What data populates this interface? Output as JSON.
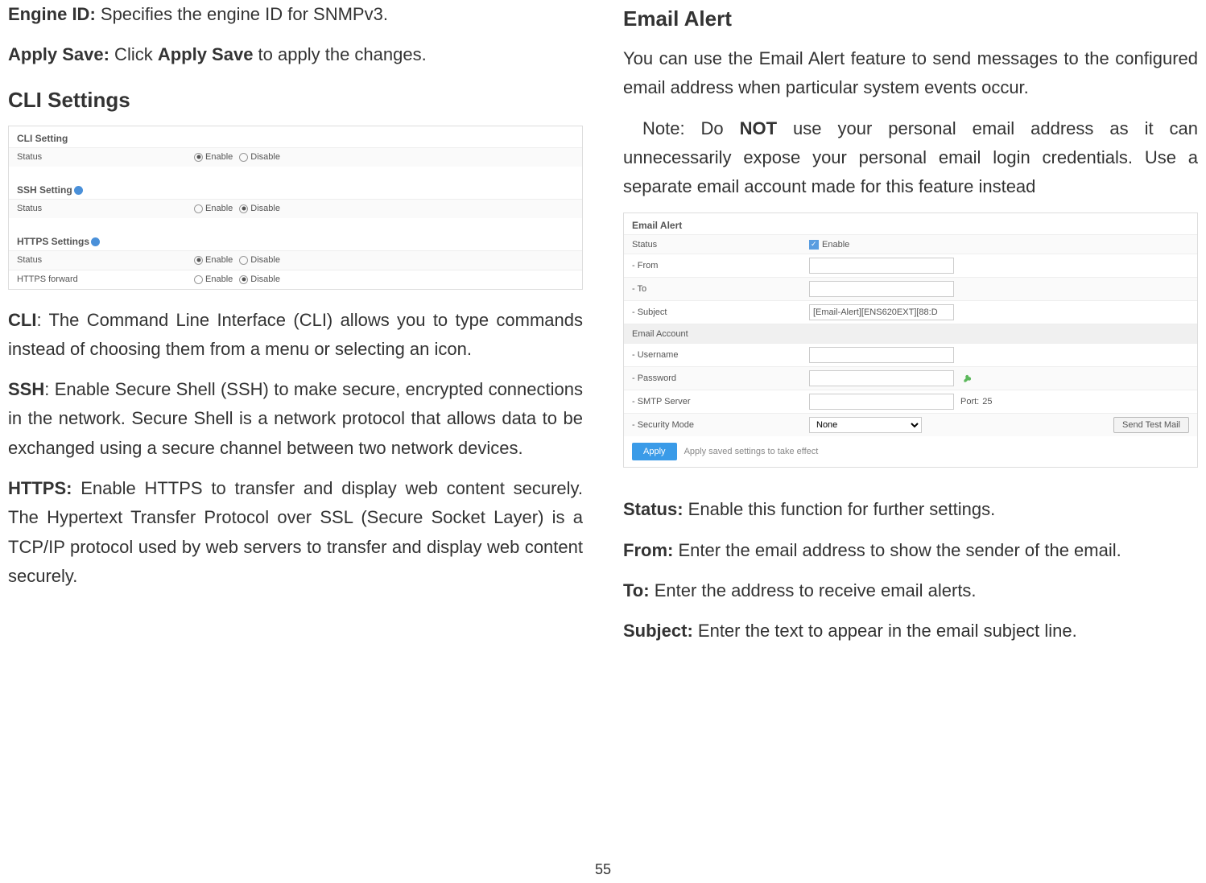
{
  "left": {
    "para1": {
      "b1": "Engine ID:",
      "t1": " Specifies the engine ID for SNMPv3."
    },
    "para2": {
      "b1": "Apply Save:",
      "t1": " Click ",
      "b2": "Apply Save",
      "t2": " to apply the changes."
    },
    "heading1": "CLI Settings",
    "fig1": {
      "cli_title": "CLI Setting",
      "ssh_title": "SSH Setting",
      "https_title": "HTTPS Settings",
      "status_label": "Status",
      "https_forward_label": "HTTPS forward",
      "enable": "Enable",
      "disable": "Disable"
    },
    "para_cli": {
      "b1": "CLI",
      "t1": ": The Command Line Interface (CLI) allows you to type commands instead of choosing them from a menu or selecting an icon."
    },
    "para_ssh": {
      "b1": "SSH",
      "t1": ": Enable Secure Shell (SSH) to make secure, encrypted connections in the network. Secure Shell is a network protocol that allows data to be exchanged using a secure channel between two network devices."
    },
    "para_https": {
      "b1": "HTTPS:",
      "t1": " Enable HTTPS to transfer and display web content securely. The Hypertext Transfer Protocol over SSL (Secure Socket Layer) is a TCP/IP protocol used by web servers to transfer and display web content securely."
    }
  },
  "right": {
    "heading1": "Email Alert",
    "para1": "You can use the Email Alert feature to send messages to the configured email address when particular system events occur.",
    "note": {
      "t1": "Note: Do ",
      "b1": "NOT",
      "t2": " use your personal email address as it can unnecessarily expose your personal email login credentials. Use a separate email account made for this feature instead"
    },
    "fig2": {
      "title": "Email Alert",
      "status_label": "Status",
      "enable": "Enable",
      "from_label": "- From",
      "to_label": "- To",
      "subject_label": "- Subject",
      "subject_value": "[Email-Alert][ENS620EXT][88:D",
      "account_label": "Email Account",
      "username_label": "- Username",
      "password_label": "- Password",
      "smtp_label": "- SMTP Server",
      "port_label": "Port:",
      "port_value": "25",
      "security_label": "- Security Mode",
      "security_value": "None",
      "send_test": "Send Test Mail",
      "apply": "Apply",
      "apply_text": "Apply saved settings to take effect"
    },
    "para_status": {
      "b1": "Status:",
      "t1": " Enable this function for further settings."
    },
    "para_from": {
      "b1": "From:",
      "t1": " Enter the email address to show the sender of the email."
    },
    "para_to": {
      "b1": "To:",
      "t1": " Enter the address to receive email alerts."
    },
    "para_subject": {
      "b1": "Subject:",
      "t1": " Enter the text to appear in the email subject line."
    }
  },
  "page_number": "55"
}
